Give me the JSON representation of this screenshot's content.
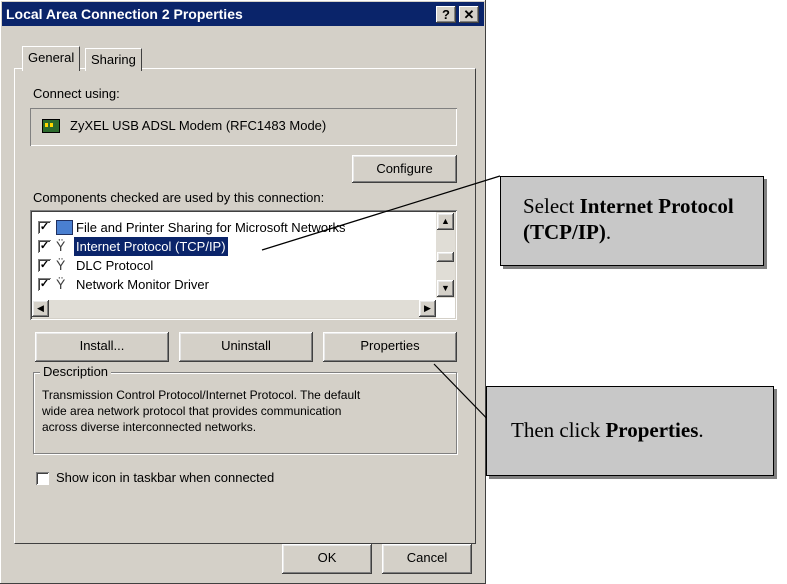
{
  "window": {
    "title": "Local Area Connection 2 Properties",
    "help_label": "?",
    "close_label": "✕"
  },
  "tabs": [
    {
      "label": "General"
    },
    {
      "label": "Sharing"
    }
  ],
  "general": {
    "connect_using_label": "Connect using:",
    "device_name": "ZyXEL USB ADSL Modem (RFC1483 Mode)",
    "configure_button": "Configure",
    "components_label": "Components checked are used by this connection:",
    "components": [
      {
        "label": "File and Printer Sharing for Microsoft Networks",
        "checked": true,
        "icon": "network-sharing-icon"
      },
      {
        "label": "Internet Protocol (TCP/IP)",
        "checked": true,
        "icon": "protocol-icon",
        "selected": true
      },
      {
        "label": "DLC Protocol",
        "checked": true,
        "icon": "protocol-icon"
      },
      {
        "label": "Network Monitor Driver",
        "checked": true,
        "icon": "protocol-icon"
      }
    ],
    "install_button": "Install...",
    "uninstall_button": "Uninstall",
    "properties_button": "Properties",
    "description_label": "Description",
    "description_lines": [
      "Transmission Control Protocol/Internet Protocol. The default",
      "wide area network protocol that provides communication",
      "across diverse interconnected networks."
    ],
    "show_icon_label": "Show icon in taskbar when connected",
    "show_icon_checked": false
  },
  "footer": {
    "ok_button": "OK",
    "cancel_button": "Cancel"
  },
  "callouts": {
    "select": {
      "prefix": "Select ",
      "bold": "Internet Protocol (TCP/IP)",
      "suffix": "."
    },
    "then": {
      "prefix": "Then click ",
      "bold": "Properties",
      "suffix": "."
    }
  }
}
